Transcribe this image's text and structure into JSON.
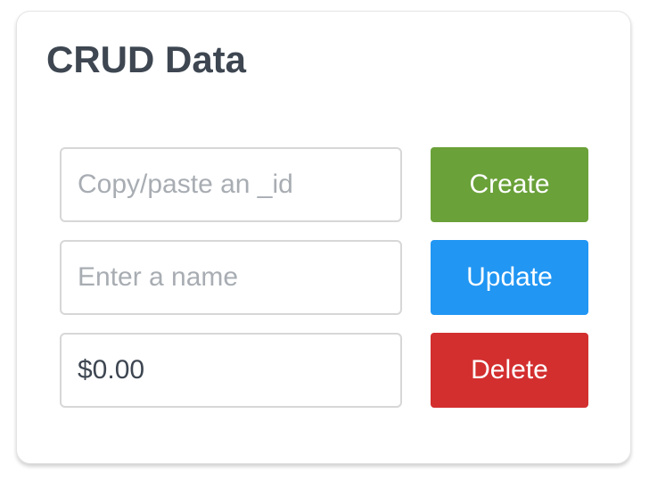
{
  "card": {
    "title": "CRUD Data"
  },
  "form": {
    "id_input": {
      "value": "",
      "placeholder": "Copy/paste an _id"
    },
    "name_input": {
      "value": "",
      "placeholder": "Enter a name"
    },
    "price_input": {
      "value": "$0.00",
      "placeholder": ""
    }
  },
  "buttons": {
    "create_label": "Create",
    "update_label": "Update",
    "delete_label": "Delete"
  },
  "colors": {
    "create": "#6aa139",
    "update": "#2196f3",
    "delete": "#d32f2f",
    "title_text": "#3d4651"
  }
}
